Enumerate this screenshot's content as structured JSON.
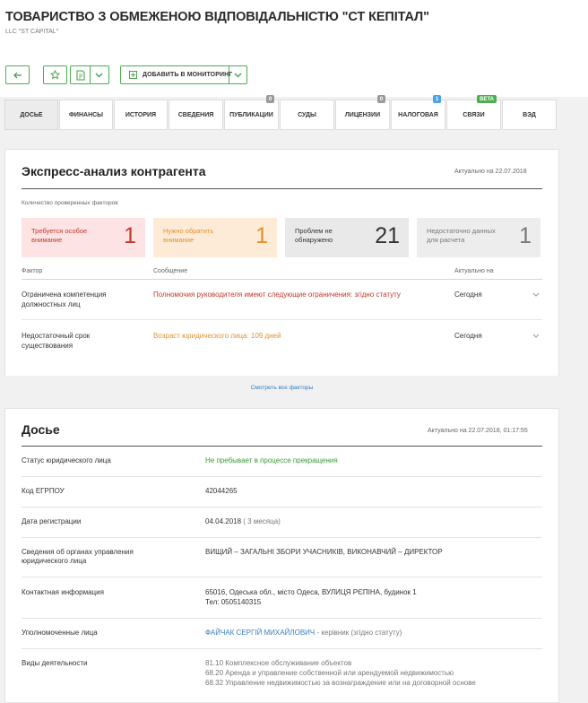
{
  "header": {
    "title": "ТОВАРИСТВО З ОБМЕЖЕНОЮ ВІДПОВІДАЛЬНІСТЮ \"СТ КЕПІТАЛ\"",
    "subtitle": "LLC \"ST CAPITAL\""
  },
  "toolbar": {
    "back_icon": "arrow-left-icon",
    "star_icon": "star-icon",
    "report_icon": "report-icon",
    "dropdown_icon": "chevron-down-icon",
    "add_monitor_label": "ДОБАВИТЬ В МОНИТОРИНГ"
  },
  "tabs": [
    {
      "label": "ДОСЬЕ",
      "badge": ""
    },
    {
      "label": "ФИНАНСЫ",
      "badge": ""
    },
    {
      "label": "ИСТОРИЯ",
      "badge": ""
    },
    {
      "label": "СВЕДЕНИЯ",
      "badge": ""
    },
    {
      "label": "ПУБЛИКАЦИИ",
      "badge": "0"
    },
    {
      "label": "СУДЫ",
      "badge": ""
    },
    {
      "label": "ЛИЦЕНЗИИ",
      "badge": "0"
    },
    {
      "label": "НАЛОГОВАЯ",
      "badge": "1"
    },
    {
      "label": "СВЯЗИ",
      "badge": "beta"
    },
    {
      "label": "ВЭД",
      "badge": ""
    }
  ],
  "express": {
    "title": "Экспресс-анализ контрагента",
    "date": "Актуально на 22.07.2018",
    "checked_label": "Количество проверенных факторов",
    "boxes": [
      {
        "label": "Требуется особое внимание",
        "value": "1"
      },
      {
        "label": "Нужно обратить внимание",
        "value": "1"
      },
      {
        "label": "Проблем не обнаружено",
        "value": "21"
      },
      {
        "label": "Недостаточно данных для расчета",
        "value": "1"
      }
    ],
    "columns": {
      "factor": "Фактор",
      "message": "Сообщение",
      "actual": "Актуально на"
    },
    "rows": [
      {
        "factor": "Ограничена компетенция должностных лиц",
        "message": "Полномочия руководителя имеют следующие ограничения: згідно статуту",
        "actual": "Сегодня"
      },
      {
        "factor": "Недостаточный срок существования",
        "message": "Возраст юридического лица: 109 дней",
        "actual": "Сегодня"
      }
    ],
    "show_all": "Смотреть все факторы"
  },
  "dossier": {
    "title": "Досье",
    "date": "Актуально на 22.07.2018, 01:17:55",
    "status_label": "Статус юридического лица",
    "status_value": "Не пребывает в процессе прекращения",
    "code_label": "Код ЕГРПОУ",
    "code_value": "42044265",
    "reg_label": "Дата регистрации",
    "reg_value": "04.04.2018",
    "reg_age": "( 3 месяца)",
    "gov_label": "Сведения об органах управления юридического лица",
    "gov_value": "ВИЩИЙ – ЗАГАЛЬНІ ЗБОРИ УЧАСНИКІВ, ВИКОНАВЧИЙ – ДИРЕКТОР",
    "contact_label": "Контактная информация",
    "contact_address": "65016, Одеська обл., місто Одеса, ВУЛИЦЯ РЄПІНА, будинок 1",
    "contact_phone": "Тел: 0505140315",
    "person_label": "Уполномоченные лица",
    "person_name": "ФАЙЧАК СЕРГІЙ МИХАЙЛОВИЧ",
    "person_role": " - керівник (згідно статуту)",
    "activities_label": "Виды деятельности",
    "activities": [
      "81.10 Комплексное обслуживание объектов",
      "68.20 Аренда и управление собственной или арендуемой недвижимостью",
      "68.32 Управление недвижимостью за вознаграждение или на договорной основе"
    ]
  }
}
